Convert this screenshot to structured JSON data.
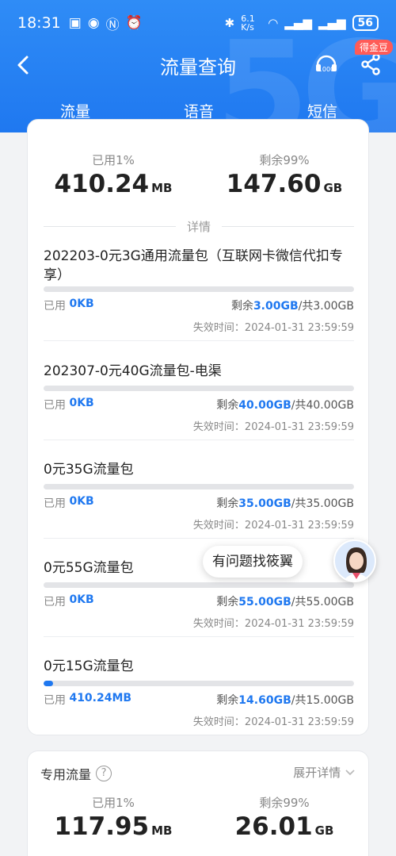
{
  "status": {
    "time": "18:31",
    "net_speed": "6.1 K/s",
    "battery": "56"
  },
  "header": {
    "title": "流量查询",
    "badge": "得金豆",
    "tabs": [
      {
        "label": "流量"
      },
      {
        "label": "语音"
      },
      {
        "label": "短信"
      }
    ],
    "active_tab": 0,
    "accent": "#1f78f0"
  },
  "general": {
    "used_label": "已用1%",
    "used_value": "410.24",
    "used_unit": "MB",
    "remain_label": "剩余99%",
    "remain_value": "147.60",
    "remain_unit": "GB",
    "details_label": "详情"
  },
  "packages": [
    {
      "name": "202203-0元3G通用流量包（互联网卡微信代扣专享）",
      "used_label": "已用",
      "used": "0KB",
      "remain_label": "剩余",
      "remain": "3.00GB",
      "total": "/共3.00GB",
      "expire_label": "失效时间：",
      "expire": "2024-01-31 23:59:59",
      "used_fraction": 0.0
    },
    {
      "name": "202307-0元40G流量包-电渠",
      "used_label": "已用",
      "used": "0KB",
      "remain_label": "剩余",
      "remain": "40.00GB",
      "total": "/共40.00GB",
      "expire_label": "失效时间：",
      "expire": "2024-01-31 23:59:59",
      "used_fraction": 0.0
    },
    {
      "name": "0元35G流量包",
      "used_label": "已用",
      "used": "0KB",
      "remain_label": "剩余",
      "remain": "35.00GB",
      "total": "/共35.00GB",
      "expire_label": "失效时间：",
      "expire": "2024-01-31 23:59:59",
      "used_fraction": 0.0
    },
    {
      "name": "0元55G流量包",
      "used_label": "已用",
      "used": "0KB",
      "remain_label": "剩余",
      "remain": "55.00GB",
      "total": "/共55.00GB",
      "expire_label": "失效时间：",
      "expire": "2024-01-31 23:59:59",
      "used_fraction": 0.0
    },
    {
      "name": "0元15G流量包",
      "used_label": "已用",
      "used": "410.24MB",
      "remain_label": "剩余",
      "remain": "14.60GB",
      "total": "/共15.00GB",
      "expire_label": "失效时间：",
      "expire": "2024-01-31 23:59:59",
      "used_fraction": 0.027
    }
  ],
  "assistant": {
    "bubble": "有问题找筱翼"
  },
  "special": {
    "title": "专用流量",
    "expand_label": "展开详情",
    "used_label": "已用1%",
    "used_value": "117.95",
    "used_unit": "MB",
    "remain_label": "剩余99%",
    "remain_value": "26.01",
    "remain_unit": "GB"
  }
}
